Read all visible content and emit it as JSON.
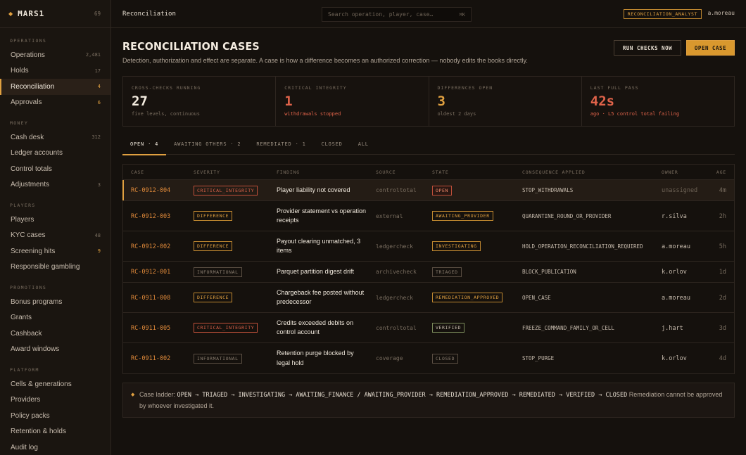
{
  "brand": {
    "name": "MARS1",
    "count": "69"
  },
  "sidebar": {
    "sections": [
      {
        "label": "OPERATIONS",
        "items": [
          {
            "label": "Operations",
            "count": "2,481"
          },
          {
            "label": "Holds",
            "count": "17"
          },
          {
            "label": "Reconciliation",
            "count": "4",
            "active": true
          },
          {
            "label": "Approvals",
            "count": "6"
          }
        ]
      },
      {
        "label": "MONEY",
        "items": [
          {
            "label": "Cash desk",
            "count": "312"
          },
          {
            "label": "Ledger accounts",
            "count": ""
          },
          {
            "label": "Control totals",
            "count": ""
          },
          {
            "label": "Adjustments",
            "count": "3"
          }
        ]
      },
      {
        "label": "PLAYERS",
        "items": [
          {
            "label": "Players",
            "count": ""
          },
          {
            "label": "KYC cases",
            "count": "48"
          },
          {
            "label": "Screening hits",
            "count": "9"
          },
          {
            "label": "Responsible gambling",
            "count": ""
          }
        ]
      },
      {
        "label": "PROMOTIONS",
        "items": [
          {
            "label": "Bonus programs",
            "count": ""
          },
          {
            "label": "Grants",
            "count": ""
          },
          {
            "label": "Cashback",
            "count": ""
          },
          {
            "label": "Award windows",
            "count": ""
          }
        ]
      },
      {
        "label": "PLATFORM",
        "items": [
          {
            "label": "Cells & generations",
            "count": ""
          },
          {
            "label": "Providers",
            "count": ""
          },
          {
            "label": "Policy packs",
            "count": ""
          },
          {
            "label": "Retention & holds",
            "count": ""
          },
          {
            "label": "Audit log",
            "count": ""
          }
        ]
      }
    ]
  },
  "topbar": {
    "breadcrumb": "Reconciliation",
    "search_placeholder": "Search operation, player, case…",
    "search_shortcut": "⌘K",
    "role": "RECONCILIATION_ANALYST",
    "user": "a.moreau"
  },
  "page": {
    "title": "RECONCILIATION CASES",
    "subtitle": "Detection, authorization and effect are separate. A case is how a difference becomes an authorized correction — nobody edits the books directly.",
    "run_checks_label": "RUN CHECKS NOW",
    "open_case_label": "OPEN CASE"
  },
  "stats": [
    {
      "label": "CROSS-CHECKS RUNNING",
      "value": "27",
      "note": "five levels, continuous",
      "tone": "white"
    },
    {
      "label": "CRITICAL INTEGRITY",
      "value": "1",
      "note": "withdrawals stopped",
      "tone": "red"
    },
    {
      "label": "DIFFERENCES OPEN",
      "value": "3",
      "note": "oldest 2 days",
      "tone": "amber"
    },
    {
      "label": "LAST FULL PASS",
      "value": "42s",
      "note": "ago · L5 control total failing",
      "tone": "red"
    }
  ],
  "tabs": [
    {
      "label": "OPEN · 4",
      "active": true
    },
    {
      "label": "AWAITING OTHERS · 2"
    },
    {
      "label": "REMEDIATED · 1"
    },
    {
      "label": "CLOSED"
    },
    {
      "label": "ALL"
    }
  ],
  "table": {
    "columns": [
      "CASE",
      "SEVERITY",
      "FINDING",
      "SOURCE",
      "STATE",
      "CONSEQUENCE APPLIED",
      "OWNER",
      "AGE"
    ],
    "rows": [
      {
        "case": "RC-0912-004",
        "severity": "CRITICAL_INTEGRITY",
        "sev_tone": "red",
        "finding": "Player liability not covered",
        "source": "controltotal",
        "state": "OPEN",
        "state_tone": "red-fill",
        "consequence": "STOP_WITHDRAWALS",
        "owner": "unassigned",
        "age": "4m",
        "selected": true
      },
      {
        "case": "RC-0912-003",
        "severity": "DIFFERENCE",
        "sev_tone": "amber",
        "finding": "Provider statement vs operation receipts",
        "source": "external",
        "state": "AWAITING_PROVIDER",
        "state_tone": "amber",
        "consequence": "QUARANTINE_ROUND_OR_PROVIDER",
        "owner": "r.silva",
        "age": "2h"
      },
      {
        "case": "RC-0912-002",
        "severity": "DIFFERENCE",
        "sev_tone": "amber",
        "finding": "Payout clearing unmatched, 3 items",
        "source": "ledgercheck",
        "state": "INVESTIGATING",
        "state_tone": "amber",
        "consequence": "HOLD_OPERATION_RECONCILIATION_REQUIRED",
        "owner": "a.moreau",
        "age": "5h"
      },
      {
        "case": "RC-0912-001",
        "severity": "INFORMATIONAL",
        "sev_tone": "grey",
        "finding": "Parquet partition digest drift",
        "source": "archivecheck",
        "state": "TRIAGED",
        "state_tone": "grey",
        "consequence": "BLOCK_PUBLICATION",
        "owner": "k.orlov",
        "age": "1d"
      },
      {
        "case": "RC-0911-008",
        "severity": "DIFFERENCE",
        "sev_tone": "amber",
        "finding": "Chargeback fee posted without predecessor",
        "source": "ledgercheck",
        "state": "REMEDIATION_APPROVED",
        "state_tone": "amber",
        "consequence": "OPEN_CASE",
        "owner": "a.moreau",
        "age": "2d"
      },
      {
        "case": "RC-0911-005",
        "severity": "CRITICAL_INTEGRITY",
        "sev_tone": "red",
        "finding": "Credits exceeded debits on control account",
        "source": "controltotal",
        "state": "VERIFIED",
        "state_tone": "olive",
        "consequence": "FREEZE_COMMAND_FAMILY_OR_CELL",
        "owner": "j.hart",
        "age": "3d"
      },
      {
        "case": "RC-0911-002",
        "severity": "INFORMATIONAL",
        "sev_tone": "grey",
        "finding": "Retention purge blocked by legal hold",
        "source": "coverage",
        "state": "CLOSED",
        "state_tone": "grey",
        "consequence": "STOP_PURGE",
        "owner": "k.orlov",
        "age": "4d"
      }
    ]
  },
  "ladder": {
    "prefix": "Case ladder:",
    "chain": "OPEN → TRIAGED → INVESTIGATING → AWAITING_FINANCE / AWAITING_PROVIDER → REMEDIATION_APPROVED → REMEDIATED → VERIFIED → CLOSED",
    "suffix": "Remediation cannot be approved by whoever investigated it."
  },
  "colors": {
    "accent": "#e0a040",
    "critical": "#e0634a",
    "background": "#15110d"
  }
}
